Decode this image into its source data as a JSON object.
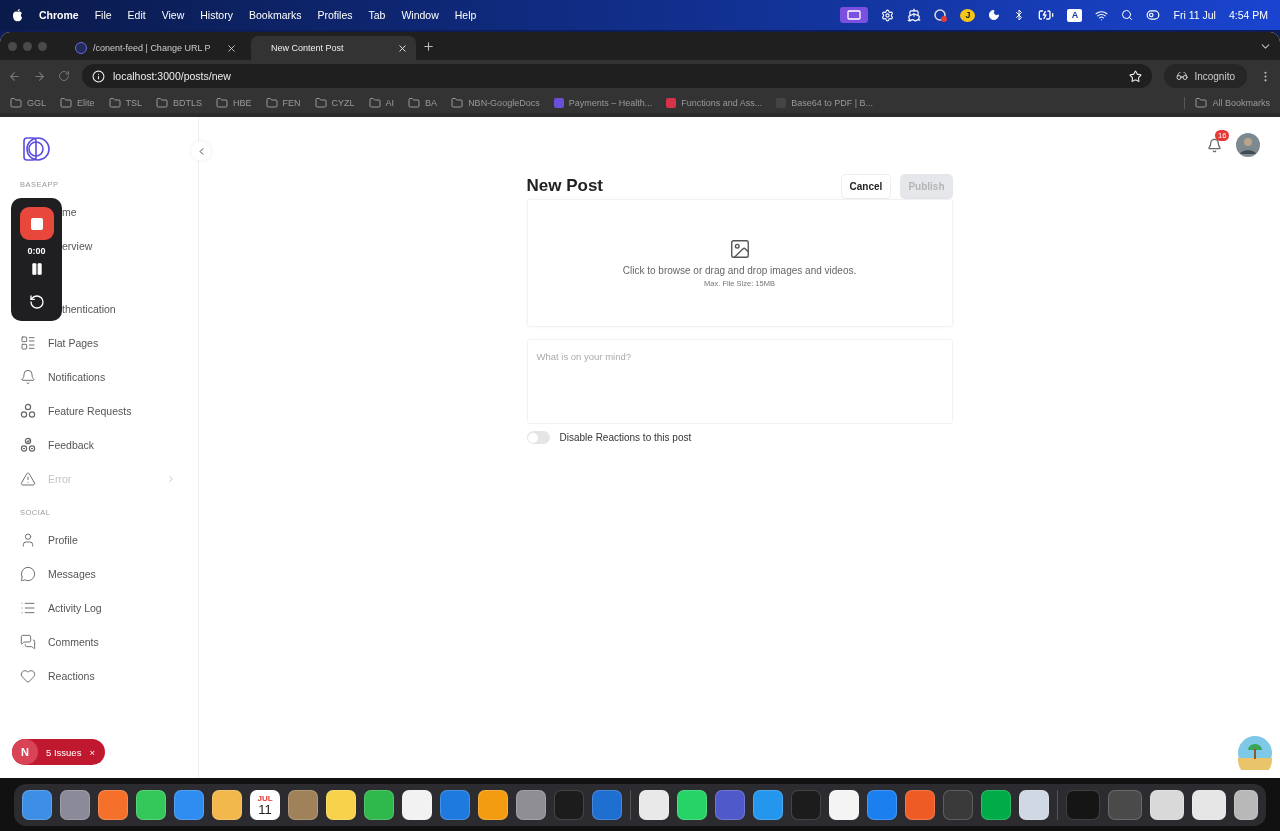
{
  "menubar": {
    "app": "Chrome",
    "menus": [
      "File",
      "Edit",
      "View",
      "History",
      "Bookmarks",
      "Profiles",
      "Tab",
      "Window",
      "Help"
    ],
    "user_badge": "J",
    "input_source": "A",
    "date": "Fri 11 Jul",
    "time": "4:54 PM"
  },
  "browser": {
    "tabs": [
      {
        "title": "/conent-feed | Change URL P",
        "selected": false
      },
      {
        "title": "New Content Post",
        "selected": true
      }
    ],
    "url": "localhost:3000/posts/new",
    "profile": "Incognito",
    "bookmarks": [
      {
        "label": "GGL",
        "kind": "folder"
      },
      {
        "label": "Elite",
        "kind": "folder"
      },
      {
        "label": "TSL",
        "kind": "folder"
      },
      {
        "label": "BDTLS",
        "kind": "folder"
      },
      {
        "label": "HBE",
        "kind": "folder"
      },
      {
        "label": "FEN",
        "kind": "folder"
      },
      {
        "label": "CYZL",
        "kind": "folder"
      },
      {
        "label": "AI",
        "kind": "folder"
      },
      {
        "label": "BA",
        "kind": "folder"
      },
      {
        "label": "NBN-GoogleDocs",
        "kind": "folder"
      },
      {
        "label": "Payments – Health...",
        "kind": "site",
        "color": "#6b4fd8"
      },
      {
        "label": "Functions and Ass...",
        "kind": "site",
        "color": "#d6334a"
      },
      {
        "label": "Base64 to PDF | B...",
        "kind": "site",
        "color": "#444444"
      }
    ],
    "all_bookmarks": "All Bookmarks"
  },
  "sidebar": {
    "sections": [
      {
        "title": "BASEAPP",
        "items": [
          {
            "label": "me",
            "kind": "covered",
            "disabled": false
          },
          {
            "label": "erview",
            "kind": "covered",
            "disabled": false
          },
          {
            "label": "thentication",
            "kind": "covered",
            "disabled": false
          },
          {
            "label": "Flat Pages",
            "kind": "link",
            "disabled": false
          },
          {
            "label": "Notifications",
            "kind": "link",
            "disabled": false
          },
          {
            "label": "Feature Requests",
            "kind": "link",
            "disabled": false
          },
          {
            "label": "Feedback",
            "kind": "link",
            "disabled": false
          },
          {
            "label": "Error",
            "kind": "group",
            "disabled": true
          }
        ]
      },
      {
        "title": "SOCIAL",
        "items": [
          {
            "label": "Profile",
            "kind": "link",
            "disabled": false
          },
          {
            "label": "Messages",
            "kind": "link",
            "disabled": false
          },
          {
            "label": "Activity Log",
            "kind": "link",
            "disabled": false
          },
          {
            "label": "Comments",
            "kind": "link",
            "disabled": false
          },
          {
            "label": "Reactions",
            "kind": "link",
            "disabled": false
          }
        ]
      }
    ]
  },
  "recorder": {
    "timer": "0:00"
  },
  "header": {
    "notification_count": "16"
  },
  "post": {
    "title": "New Post",
    "cancel": "Cancel",
    "publish": {
      "label": "Publish",
      "disabled": true
    },
    "upload_hint": "Click to browse or drag and drop images and videos.",
    "upload_limit": "Max. File Size: 15MB",
    "text_placeholder": "What is on your mind?",
    "disable_reactions": {
      "label": "Disable Reactions to this post",
      "on": false
    }
  },
  "issues": {
    "initial": "N",
    "label": "5 Issues",
    "close": "×"
  },
  "dock": {
    "apps": [
      {
        "color": "#3d8fe6",
        "kind": "app"
      },
      {
        "color": "#8a8a99",
        "kind": "app"
      },
      {
        "color": "#f5702a",
        "kind": "app"
      },
      {
        "color": "#34c759",
        "kind": "app"
      },
      {
        "color": "#2f8cf0",
        "kind": "app"
      },
      {
        "color": "#f2b84c",
        "kind": "app"
      },
      {
        "color": "#ffffff",
        "kind": "calendar",
        "month": "JUL",
        "day": "11"
      },
      {
        "color": "#a0825a",
        "kind": "app"
      },
      {
        "color": "#f7d24a",
        "kind": "app"
      },
      {
        "color": "#2fb84b",
        "kind": "app"
      },
      {
        "color": "#f2f2f2",
        "kind": "app"
      },
      {
        "color": "#1f7ae0",
        "kind": "app"
      },
      {
        "color": "#f39c12",
        "kind": "app"
      },
      {
        "color": "#8e8e93",
        "kind": "app"
      },
      {
        "color": "#1c1c1c",
        "kind": "app"
      },
      {
        "color": "#1f6fd1",
        "kind": "app"
      }
    ],
    "pinned": [
      {
        "color": "#e9e9e9",
        "kind": "app"
      },
      {
        "color": "#25d366",
        "kind": "app"
      },
      {
        "color": "#5059c9",
        "kind": "app"
      },
      {
        "color": "#2496ed",
        "kind": "app"
      },
      {
        "color": "#1c1c1c",
        "kind": "app"
      },
      {
        "color": "#f4f4f4",
        "kind": "app"
      },
      {
        "color": "#1b7ff0",
        "kind": "app"
      },
      {
        "color": "#ef5b25",
        "kind": "app"
      },
      {
        "color": "#3a3a3a",
        "kind": "app"
      },
      {
        "color": "#00ac47",
        "kind": "app"
      },
      {
        "color": "#cfd8e3",
        "kind": "app"
      }
    ],
    "windows": [
      {
        "color": "#151515",
        "kind": "window"
      },
      {
        "color": "#4a4a4a",
        "kind": "window"
      },
      {
        "color": "#d9d9d9",
        "kind": "window"
      },
      {
        "color": "#e6e6e6",
        "kind": "window"
      },
      {
        "color": "#b8b8b8",
        "kind": "trash"
      }
    ]
  }
}
